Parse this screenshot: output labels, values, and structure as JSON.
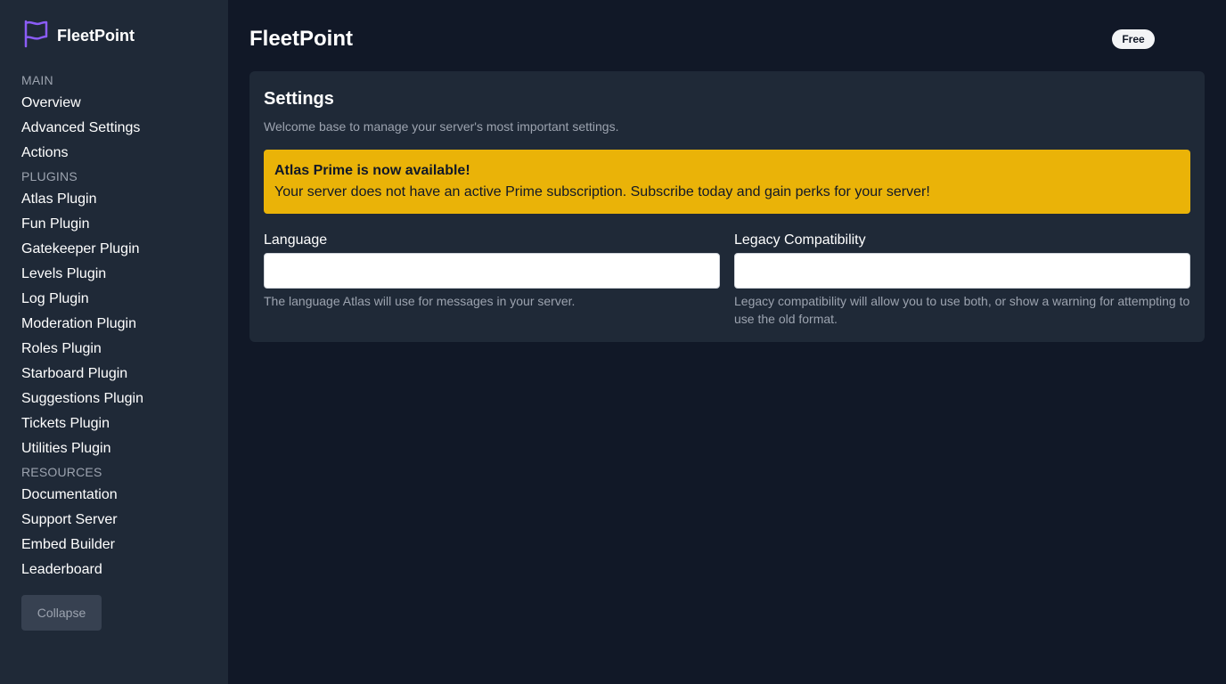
{
  "app": {
    "name": "FleetPoint",
    "accent_color": "#8b5cf6",
    "logo_icon": "flag-icon"
  },
  "sidebar": {
    "sections": [
      {
        "title": "MAIN",
        "items": [
          {
            "label": "Overview"
          },
          {
            "label": "Advanced Settings"
          },
          {
            "label": "Actions"
          }
        ]
      },
      {
        "title": "PLUGINS",
        "items": [
          {
            "label": "Atlas Plugin"
          },
          {
            "label": "Fun Plugin"
          },
          {
            "label": "Gatekeeper Plugin"
          },
          {
            "label": "Levels Plugin"
          },
          {
            "label": "Log Plugin"
          },
          {
            "label": "Moderation Plugin"
          },
          {
            "label": "Roles Plugin"
          },
          {
            "label": "Starboard Plugin"
          },
          {
            "label": "Suggestions Plugin"
          },
          {
            "label": "Tickets Plugin"
          },
          {
            "label": "Utilities Plugin"
          }
        ]
      },
      {
        "title": "RESOURCES",
        "items": [
          {
            "label": "Documentation"
          },
          {
            "label": "Support Server"
          },
          {
            "label": "Embed Builder"
          },
          {
            "label": "Leaderboard"
          }
        ]
      }
    ],
    "collapse_label": "Collapse"
  },
  "header": {
    "title": "FleetPoint",
    "plan_badge": "Free"
  },
  "settings": {
    "title": "Settings",
    "description": "Welcome base to manage your server's most important settings.",
    "alert": {
      "title": "Atlas Prime is now available!",
      "body": "Your server does not have an active Prime subscription. Subscribe today and gain perks for your server!",
      "color": "#eab308"
    },
    "fields": {
      "language": {
        "label": "Language",
        "value": "",
        "help": "The language Atlas will use for messages in your server."
      },
      "legacy": {
        "label": "Legacy Compatibility",
        "value": "",
        "help": "Legacy compatibility will allow you to use both, or show a warning for attempting to use the old format."
      }
    }
  }
}
